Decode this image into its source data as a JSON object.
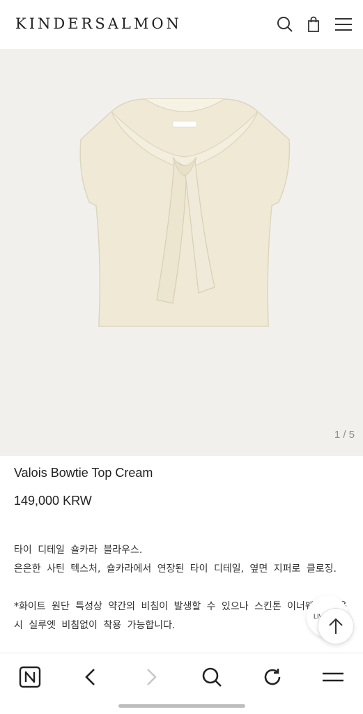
{
  "header": {
    "logo": "KINDERSALMON",
    "icons": [
      "search-icon",
      "shopping-bag-icon",
      "menu-icon"
    ]
  },
  "gallery": {
    "counter": "1 / 5",
    "background": "#f1f0ed"
  },
  "product": {
    "name": "Valois Bowtie Top Cream",
    "price": "149,000 KRW",
    "description": [
      "타이 디테일 숄카라 블라우스.",
      "은은한 사틴 텍스처, 숄카라에서 연장된 타이 디테일, 옆면 지퍼로 클로징.",
      "",
      "*화이트 원단 특성상 약간의 비침이 발생할 수 있으나 스킨톤 이너웨어 착용시 실루엣 비침없이 착용 가능합니다."
    ]
  },
  "floating": {
    "live_label": "LIV",
    "top_icon": "arrow-up-icon"
  },
  "browser_bar": {
    "icons": [
      "naver-n-icon",
      "back-icon",
      "forward-icon",
      "search-icon",
      "refresh-icon",
      "menu-icon"
    ]
  }
}
